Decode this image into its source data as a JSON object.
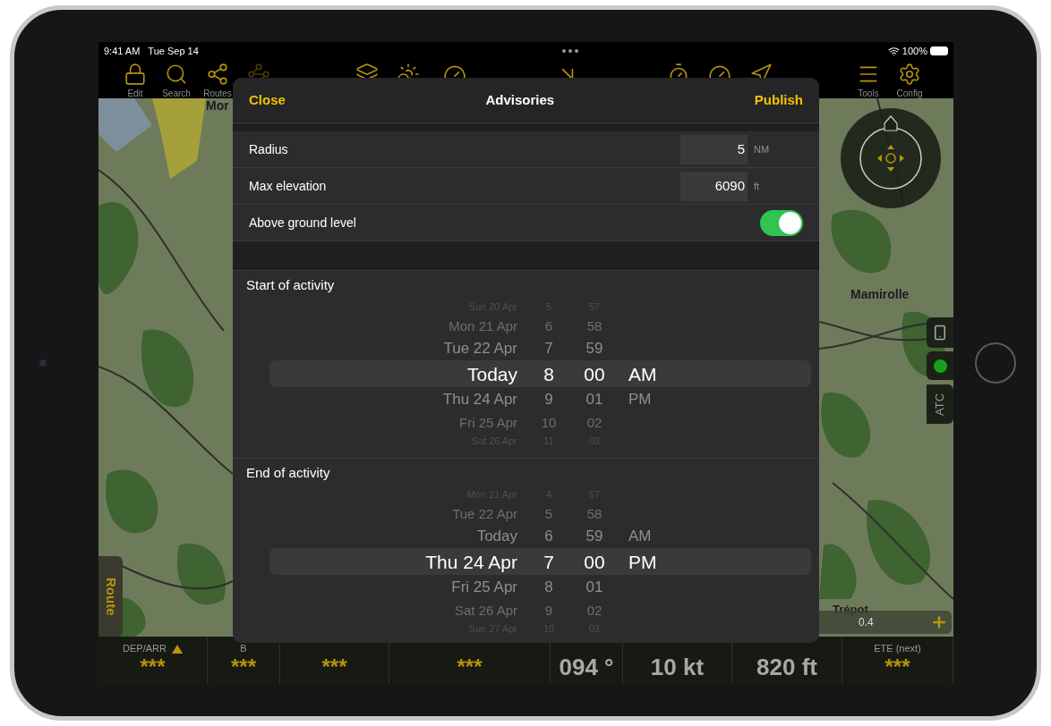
{
  "status_bar": {
    "time": "9:41 AM",
    "date": "Tue Sep 14",
    "battery": "100%"
  },
  "toolbar": {
    "items": [
      {
        "label": "Edit"
      },
      {
        "label": "Search"
      },
      {
        "label": "Routes"
      },
      {
        "label": "Tools"
      },
      {
        "label": "Config"
      }
    ]
  },
  "map": {
    "labels": [
      {
        "text": "Mor"
      },
      {
        "text": "Mamirolle"
      },
      {
        "text": "Trépot"
      }
    ],
    "scale": "0.4",
    "route_tab": "Route",
    "atc_button": "ATC"
  },
  "dialog": {
    "title": "Advisories",
    "close": "Close",
    "publish": "Publish",
    "rows": [
      {
        "kind": "number",
        "label": "Radius",
        "value": "5",
        "unit": "NM"
      },
      {
        "kind": "number",
        "label": "Max elevation",
        "value": "6090",
        "unit": "ft"
      },
      {
        "kind": "toggle",
        "label": "Above ground level",
        "on": true
      }
    ],
    "pickers": [
      {
        "title": "Start of activity",
        "columns": [
          {
            "items": [
              {
                "text": "Sun 20 Apr",
                "selected": false
              },
              {
                "text": "Mon 21 Apr",
                "selected": false
              },
              {
                "text": "Tue 22 Apr",
                "selected": false
              },
              {
                "text": "Today",
                "selected": true
              },
              {
                "text": "Thu 24 Apr",
                "selected": false
              },
              {
                "text": "Fri 25 Apr",
                "selected": false
              },
              {
                "text": "Sat 26 Apr",
                "selected": false
              }
            ]
          },
          {
            "items": [
              {
                "text": "5",
                "selected": false
              },
              {
                "text": "6",
                "selected": false
              },
              {
                "text": "7",
                "selected": false
              },
              {
                "text": "8",
                "selected": true
              },
              {
                "text": "9",
                "selected": false
              },
              {
                "text": "10",
                "selected": false
              },
              {
                "text": "11",
                "selected": false
              }
            ]
          },
          {
            "items": [
              {
                "text": "57",
                "selected": false
              },
              {
                "text": "58",
                "selected": false
              },
              {
                "text": "59",
                "selected": false
              },
              {
                "text": "00",
                "selected": true
              },
              {
                "text": "01",
                "selected": false
              },
              {
                "text": "02",
                "selected": false
              },
              {
                "text": "03",
                "selected": false
              }
            ]
          },
          {
            "items": [
              {
                "text": "AM",
                "selected": true
              },
              {
                "text": "PM",
                "selected": false
              }
            ]
          }
        ]
      },
      {
        "title": "End of activity",
        "columns": [
          {
            "items": [
              {
                "text": "Mon 21 Apr",
                "selected": false
              },
              {
                "text": "Tue 22 Apr",
                "selected": false
              },
              {
                "text": "Today",
                "selected": false
              },
              {
                "text": "Thu 24 Apr",
                "selected": true
              },
              {
                "text": "Fri 25 Apr",
                "selected": false
              },
              {
                "text": "Sat 26 Apr",
                "selected": false
              },
              {
                "text": "Sun 27 Apr",
                "selected": false
              }
            ]
          },
          {
            "items": [
              {
                "text": "4",
                "selected": false
              },
              {
                "text": "5",
                "selected": false
              },
              {
                "text": "6",
                "selected": false
              },
              {
                "text": "7",
                "selected": true
              },
              {
                "text": "8",
                "selected": false
              },
              {
                "text": "9",
                "selected": false
              },
              {
                "text": "10",
                "selected": false
              }
            ]
          },
          {
            "items": [
              {
                "text": "57",
                "selected": false
              },
              {
                "text": "58",
                "selected": false
              },
              {
                "text": "59",
                "selected": false
              },
              {
                "text": "00",
                "selected": true
              },
              {
                "text": "01",
                "selected": false
              },
              {
                "text": "02",
                "selected": false
              },
              {
                "text": "03",
                "selected": false
              }
            ]
          },
          {
            "items": [
              {
                "text": "AM",
                "selected": false
              },
              {
                "text": "PM",
                "selected": true
              }
            ]
          }
        ]
      }
    ]
  },
  "bottom_bar": {
    "cells": [
      {
        "label": "DEP/ARR",
        "value": "***",
        "kind": "empty"
      },
      {
        "label": "B",
        "value": "***",
        "kind": "empty"
      },
      {
        "value": "***",
        "kind": "empty"
      },
      {
        "value": "***",
        "kind": "empty"
      },
      {
        "value": "094 °",
        "kind": "value"
      },
      {
        "value": "10 kt",
        "kind": "value"
      },
      {
        "value": "820 ft",
        "kind": "value"
      },
      {
        "label": "ETE (next)",
        "value": "***",
        "kind": "empty"
      }
    ]
  }
}
